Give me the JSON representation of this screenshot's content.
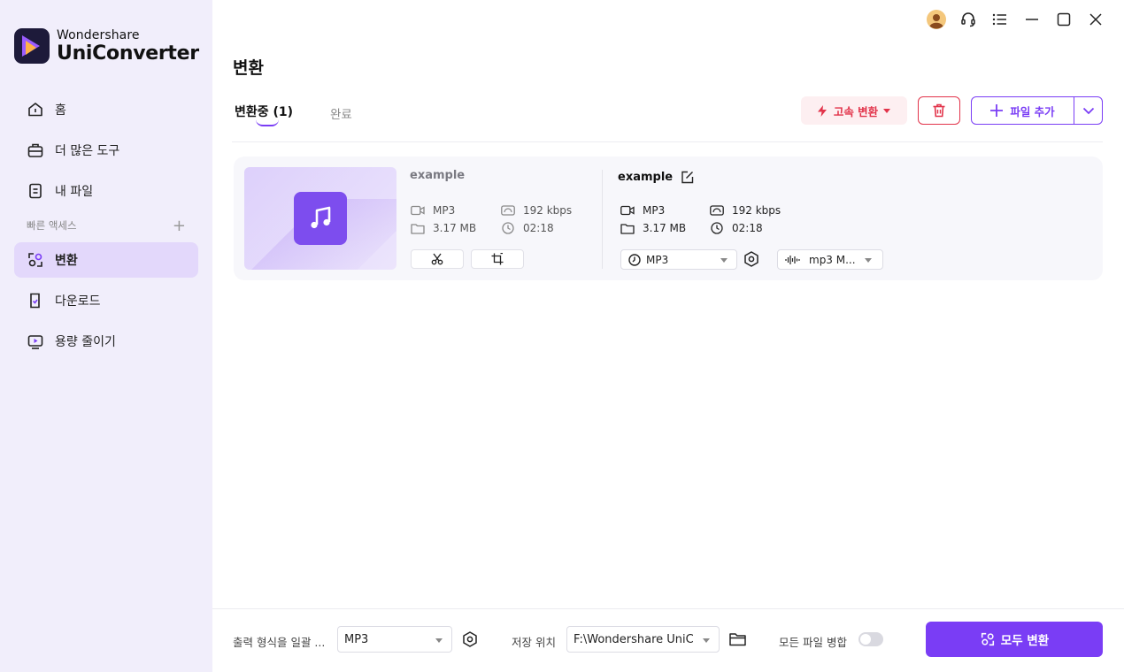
{
  "app": {
    "brand_small": "Wondershare",
    "brand_big": "UniConverter",
    "accent_color": "#7a3df5",
    "danger_color": "#e2334a"
  },
  "sidebar": {
    "items": [
      {
        "label": "홈",
        "icon": "home-icon"
      },
      {
        "label": "더 많은 도구",
        "icon": "toolbox-icon"
      },
      {
        "label": "내 파일",
        "icon": "my-files-icon"
      }
    ],
    "section_label": "빠른 액세스",
    "section_plus": "+",
    "quick_items": [
      {
        "label": "변환",
        "icon": "convert-icon",
        "active": true
      },
      {
        "label": "다운로드",
        "icon": "download-icon"
      },
      {
        "label": "용량 줄이기",
        "icon": "compress-icon"
      }
    ]
  },
  "main": {
    "title": "변환",
    "tab_converting": "변환중 (1)",
    "tab_done": "완료",
    "fast_convert": "고속 변환",
    "add_file": "파일 추가"
  },
  "file": {
    "source": {
      "name": "example",
      "format": "MP3",
      "size": "3.17 MB",
      "bitrate": "192 kbps",
      "duration": "02:18"
    },
    "output": {
      "name": "example",
      "format": "MP3",
      "size": "3.17 MB",
      "bitrate": "192 kbps",
      "duration": "02:18",
      "format_select": "MP3",
      "audio_select": "mp3 M..."
    }
  },
  "bottom": {
    "output_format_label": "출력 형식을 일괄 ...",
    "output_format_value": "MP3",
    "save_location_label": "저장 위치",
    "save_location_value": "F:\\Wondershare UniCo",
    "merge_label": "모든 파일 병합",
    "convert_all": "모두 변환"
  }
}
